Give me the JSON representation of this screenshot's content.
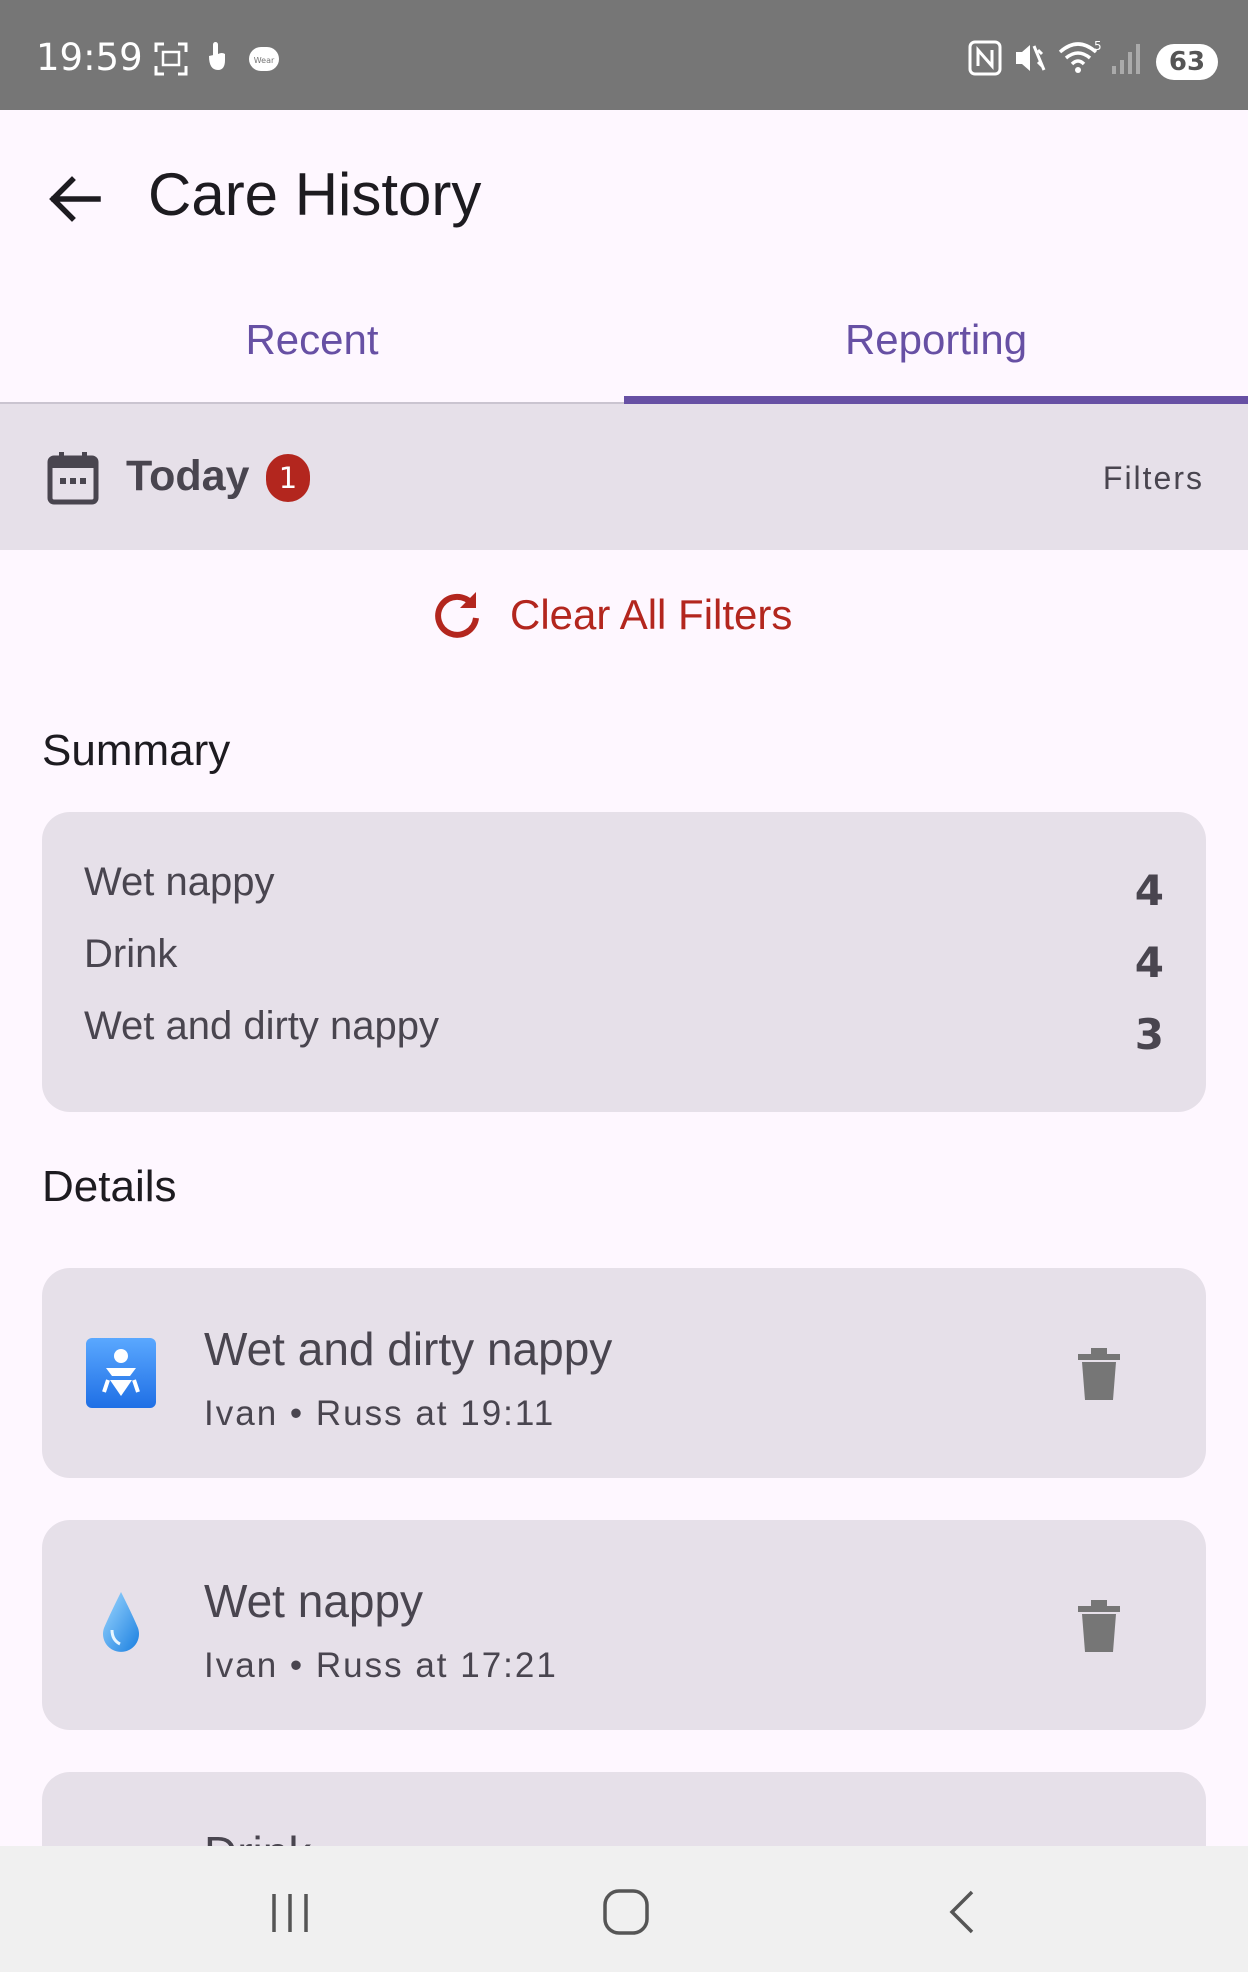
{
  "status_bar": {
    "time": "19:59",
    "battery": "63"
  },
  "app_bar": {
    "title": "Care History"
  },
  "tabs": [
    {
      "label": "Recent",
      "selected": false
    },
    {
      "label": "Reporting",
      "selected": true
    }
  ],
  "filter_bar": {
    "date_label": "Today",
    "active_filter_count": "1",
    "filters_label": "Filters"
  },
  "clear_filters": {
    "label": "Clear All Filters"
  },
  "summary": {
    "title": "Summary",
    "rows": [
      {
        "label": "Wet nappy",
        "count": "4"
      },
      {
        "label": "Drink",
        "count": "4"
      },
      {
        "label": "Wet and dirty nappy",
        "count": "3"
      }
    ]
  },
  "details": {
    "title": "Details",
    "items": [
      {
        "icon": "baby-icon",
        "title": "Wet and dirty nappy",
        "subtitle": "Ivan • Russ at 19:11"
      },
      {
        "icon": "droplet-icon",
        "title": "Wet nappy",
        "subtitle": "Ivan • Russ at 17:21"
      },
      {
        "icon": "drink-icon",
        "title": "Drink",
        "subtitle": ""
      }
    ]
  },
  "colors": {
    "accent": "#6750a4",
    "error": "#b3261e",
    "surface": "#e6e0e9",
    "background": "#fef7ff"
  }
}
